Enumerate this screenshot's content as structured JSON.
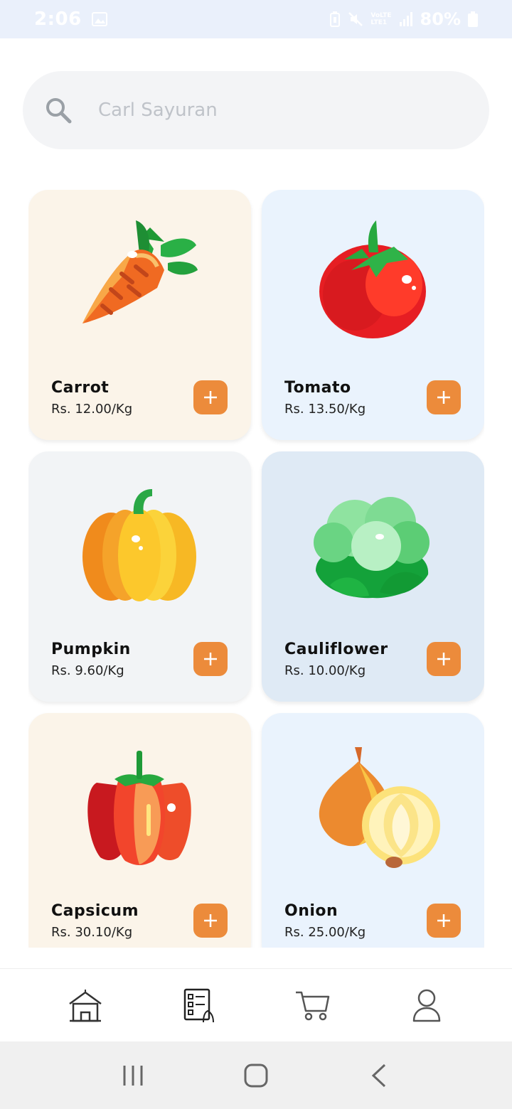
{
  "status_bar": {
    "time": "2:06",
    "battery": "80%",
    "network_label_1": "VoLTE",
    "network_label_2": "LTE1"
  },
  "search": {
    "placeholder": "Carl Sayuran",
    "value": ""
  },
  "products": [
    {
      "name": "Carrot",
      "price": "Rs. 12.00/Kg",
      "bg": "#fbf4e9",
      "icon": "carrot-icon"
    },
    {
      "name": "Tomato",
      "price": "Rs. 13.50/Kg",
      "bg": "#eaf3fd",
      "icon": "tomato-icon"
    },
    {
      "name": "Pumpkin",
      "price": "Rs. 9.60/Kg",
      "bg": "#f2f4f6",
      "icon": "pumpkin-icon"
    },
    {
      "name": "Cauliflower",
      "price": "Rs. 10.00/Kg",
      "bg": "#dfeaf5",
      "icon": "cauliflower-icon"
    },
    {
      "name": "Capsicum",
      "price": "Rs. 30.10/Kg",
      "bg": "#fbf4e9",
      "icon": "capsicum-icon"
    },
    {
      "name": "Onion",
      "price": "Rs. 25.00/Kg",
      "bg": "#eaf3fd",
      "icon": "onion-icon"
    }
  ],
  "accent_color": "#ec8b3b",
  "bottom_nav": [
    "home-icon",
    "orders-icon",
    "cart-icon",
    "profile-icon"
  ]
}
